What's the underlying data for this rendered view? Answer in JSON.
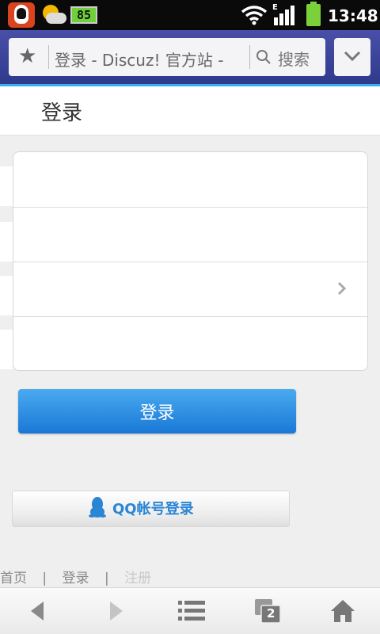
{
  "status_bar": {
    "battery_level": "85",
    "time": "13:48",
    "network_type": "E"
  },
  "browser": {
    "page_title": "登录 - Discuz! 官方站 -",
    "search_label": "搜索"
  },
  "page": {
    "title": "登录",
    "login_button": "登录",
    "qq_login": "QQ帐号登录"
  },
  "footer": {
    "home": "首页",
    "login": "登录",
    "register": "注册",
    "separator": "|"
  },
  "toolbar": {
    "tab_count": "2"
  },
  "colors": {
    "accent": "#3aaee8",
    "button": "#1978d6",
    "qq_text": "#2a85d4"
  }
}
